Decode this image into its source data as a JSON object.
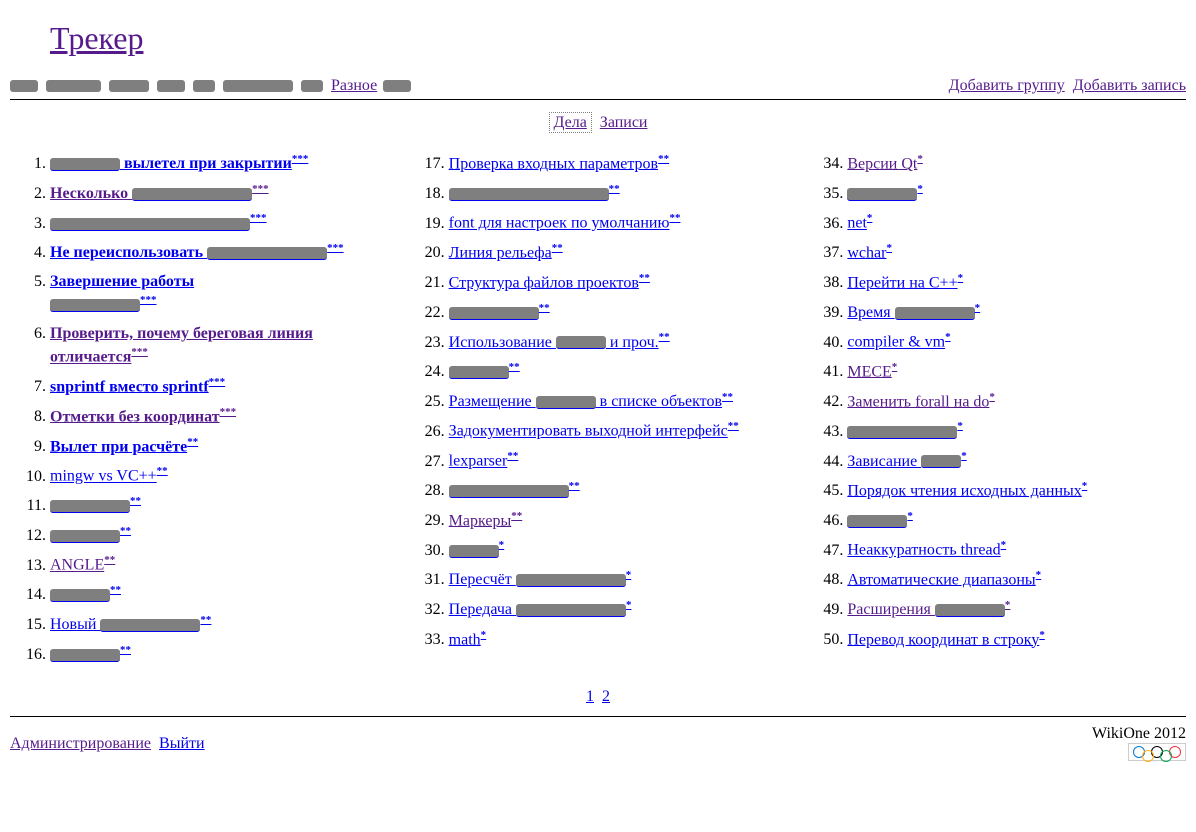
{
  "header": {
    "title": "Трекер"
  },
  "topnav": {
    "visible_link": "Разное"
  },
  "actions": {
    "add_group": "Добавить группу",
    "add_record": "Добавить запись"
  },
  "tabs": {
    "active": "Дела",
    "other": "Записи"
  },
  "columns": [
    {
      "start": 1,
      "items": [
        {
          "text": "вылетел при закрытии",
          "prefix_redacted": 70,
          "stars": "***",
          "bold": true,
          "visited": false
        },
        {
          "text": "Несколько",
          "suffix_redacted": 120,
          "stars": "***",
          "bold": true,
          "visited": true
        },
        {
          "text": "",
          "redacted_only": 200,
          "stars": "***",
          "bold": true,
          "visited": false
        },
        {
          "text": "Не переиспользовать",
          "suffix_redacted": 120,
          "stars": "***",
          "bold": true,
          "visited": false
        },
        {
          "text": "Завершение работы",
          "second_line_redacted": 90,
          "stars": "***",
          "bold": true,
          "visited": false
        },
        {
          "text": "Проверить, почему береговая линия отличается",
          "stars": "***",
          "bold": true,
          "visited": true
        },
        {
          "text": "snprintf вместо sprintf",
          "stars": "***",
          "bold": true,
          "visited": false
        },
        {
          "text": "Отметки без координат",
          "stars": "***",
          "bold": true,
          "visited": true
        },
        {
          "text": "Вылет при расчёте",
          "stars": "**",
          "bold": true,
          "visited": false
        },
        {
          "text": "mingw vs VC++",
          "stars": "**",
          "visited": false
        },
        {
          "text": "",
          "redacted_only": 80,
          "stars": "**",
          "visited": false
        },
        {
          "text": "",
          "redacted_only": 70,
          "stars": "**",
          "visited": false
        },
        {
          "text": "ANGLE",
          "stars": "**",
          "visited": true
        },
        {
          "text": "",
          "redacted_only": 60,
          "stars": "**",
          "visited": false
        },
        {
          "text": "Новый",
          "suffix_redacted": 100,
          "stars": "**",
          "visited": false
        },
        {
          "text": "",
          "redacted_only": 70,
          "stars": "**",
          "visited": false
        }
      ]
    },
    {
      "start": 17,
      "items": [
        {
          "text": "Проверка входных параметров",
          "stars": "**",
          "visited": false
        },
        {
          "text": "",
          "redacted_only": 160,
          "stars": "**",
          "visited": false
        },
        {
          "text": "font для настроек по умолчанию",
          "stars": "**",
          "visited": false
        },
        {
          "text": "Линия рельефа",
          "stars": "**",
          "visited": false
        },
        {
          "text": "Структура файлов проектов",
          "stars": "**",
          "visited": false
        },
        {
          "text": "",
          "redacted_only": 90,
          "stars": "**",
          "visited": false
        },
        {
          "text": "Использование",
          "mid_redacted": 50,
          "text2": "и проч.",
          "stars": "**",
          "visited": false
        },
        {
          "text": "",
          "redacted_only": 60,
          "stars": "**",
          "visited": false
        },
        {
          "text": "Размещение",
          "mid_redacted": 60,
          "text2": "в списке объектов",
          "stars": "**",
          "visited": false
        },
        {
          "text": "Задокументировать выходной интерфейс",
          "stars": "**",
          "visited": false
        },
        {
          "text": "lexparser",
          "stars": "**",
          "visited": false
        },
        {
          "text": "",
          "redacted_only": 120,
          "stars": "**",
          "visited": false
        },
        {
          "text": "Маркеры",
          "stars": "**",
          "visited": true
        },
        {
          "text": "",
          "redacted_only": 50,
          "stars": "*",
          "visited": false
        },
        {
          "text": "Пересчёт",
          "suffix_redacted": 110,
          "stars": "*",
          "visited": false
        },
        {
          "text": "Передача",
          "suffix_redacted": 110,
          "stars": "*",
          "visited": false
        },
        {
          "text": "math",
          "stars": "*",
          "visited": false
        }
      ]
    },
    {
      "start": 34,
      "items": [
        {
          "text": "Версии Qt",
          "stars": "*",
          "visited": true
        },
        {
          "text": "",
          "redacted_only": 70,
          "stars": "*",
          "visited": false
        },
        {
          "text": "net",
          "stars": "*",
          "visited": false
        },
        {
          "text": "wchar",
          "stars": "*",
          "visited": false
        },
        {
          "text": "Перейти на C++",
          "stars": "*",
          "visited": false
        },
        {
          "text": "Время",
          "suffix_redacted": 80,
          "stars": "*",
          "visited": false
        },
        {
          "text": "compiler & vm",
          "stars": "*",
          "visited": false
        },
        {
          "text": "MECE",
          "stars": "*",
          "visited": true
        },
        {
          "text": "Заменить forall на do",
          "stars": "*",
          "visited": true
        },
        {
          "text": "",
          "redacted_only": 110,
          "stars": "*",
          "visited": false
        },
        {
          "text": "Зависание",
          "suffix_redacted": 40,
          "stars": "*",
          "visited": false
        },
        {
          "text": "Порядок чтения исходных данных",
          "stars": "*",
          "visited": false
        },
        {
          "text": "",
          "redacted_only": 60,
          "stars": "*",
          "visited": false
        },
        {
          "text": "Неаккуратность thread",
          "stars": "*",
          "visited": false
        },
        {
          "text": "Автоматические диапазоны",
          "stars": "*",
          "visited": false
        },
        {
          "text": "Расширения",
          "suffix_redacted": 70,
          "stars": "*",
          "visited": true
        },
        {
          "text": "Перевод координат в строку",
          "stars": "*",
          "visited": false
        }
      ]
    }
  ],
  "pager": {
    "pages": [
      "1",
      "2"
    ]
  },
  "footer": {
    "admin": "Администрирование",
    "logout": "Выйти",
    "copyright": "WikiOne 2012"
  }
}
